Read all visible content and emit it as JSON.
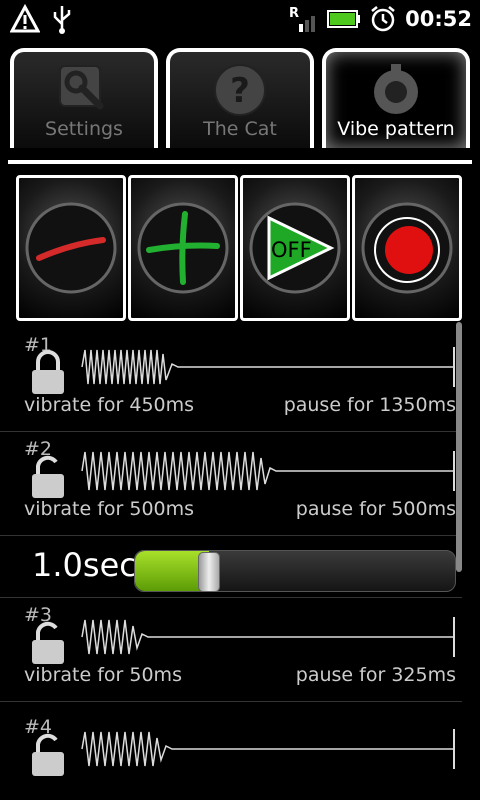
{
  "status": {
    "clock": "00:52",
    "roaming": "R"
  },
  "tabs": [
    {
      "label": "Settings",
      "icon": "wrench-icon",
      "active": false
    },
    {
      "label": "The Cat",
      "icon": "question-icon",
      "active": false
    },
    {
      "label": "Vibe pattern",
      "icon": "gear-icon",
      "active": true
    }
  ],
  "controls": {
    "remove_icon": "minus-icon",
    "add_icon": "plus-icon",
    "play_label": "OFF",
    "record_icon": "record-icon"
  },
  "rows": [
    {
      "num": "#1",
      "vibrate": "vibrate for 450ms",
      "pause": "pause for 1350ms"
    },
    {
      "num": "#2",
      "vibrate": "vibrate for 500ms",
      "pause": "pause for 500ms"
    },
    {
      "num": "#3",
      "vibrate": "vibrate for 50ms",
      "pause": "pause for 325ms"
    },
    {
      "num": "#4",
      "vibrate": "",
      "pause": ""
    }
  ],
  "slider": {
    "value_label": "1.0sec",
    "level_fraction": 0.23
  },
  "colors": {
    "accent_green": "#7cc21a",
    "record_red": "#e01010",
    "minus_red": "#d42a2a",
    "plus_green": "#22b030"
  }
}
